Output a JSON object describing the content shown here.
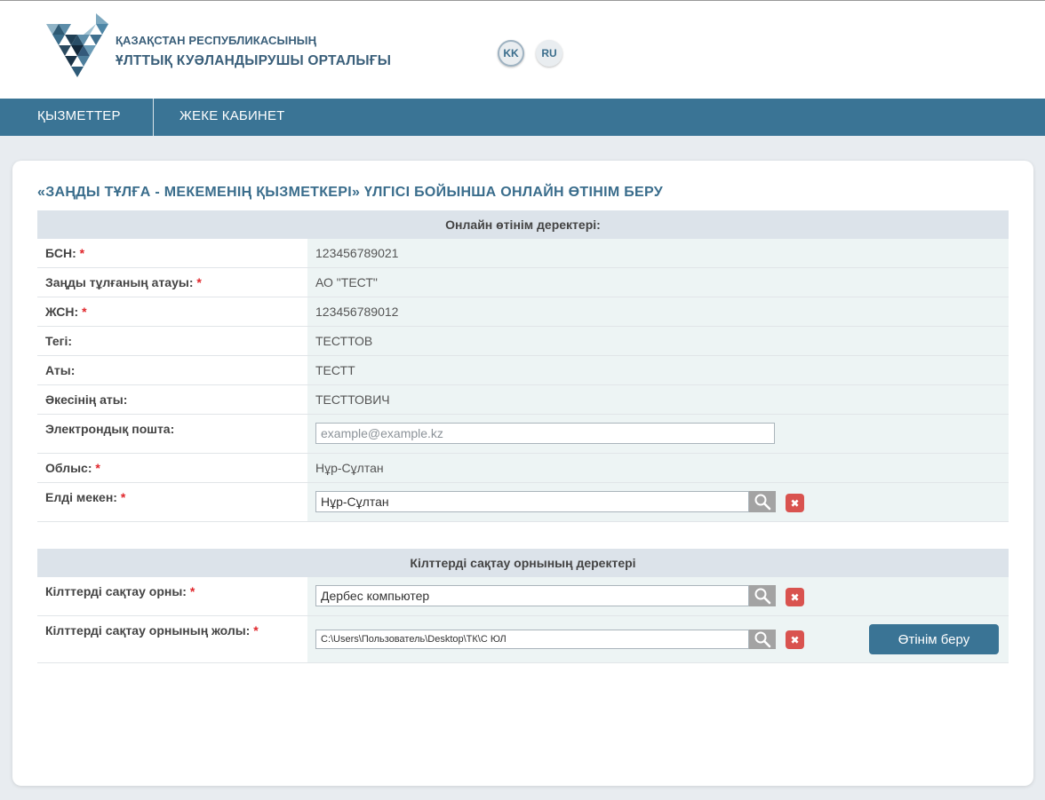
{
  "header": {
    "org_line1": "ҚАЗАҚСТАН РЕСПУБЛИКАСЫНЫҢ",
    "org_line2": "ҰЛТТЫҚ КУӘЛАНДЫРУШЫ ОРТАЛЫҒЫ",
    "languages": [
      "KK",
      "RU"
    ],
    "active_language": "KK"
  },
  "nav": {
    "items": [
      "ҚЫЗМЕТТЕР",
      "ЖЕКЕ КАБИНЕТ"
    ]
  },
  "page": {
    "title": "«ЗАҢДЫ ТҰЛҒА - МЕКЕМЕНІҢ ҚЫЗМЕТКЕРІ» ҮЛГІСІ БОЙЫНША ОНЛАЙН ӨТІНІМ БЕРУ"
  },
  "section1": {
    "title": "Онлайн өтінім деректері:",
    "bin_label": "БСН:",
    "bin_value": "123456789021",
    "org_name_label": "Заңды тұлғаның атауы:",
    "org_name_value": "АО \"ТЕСТ\"",
    "iin_label": "ЖСН:",
    "iin_value": "123456789012",
    "surname_label": "Тегі:",
    "surname_value": "ТЕСТТОВ",
    "name_label": "Аты:",
    "name_value": "ТЕСТТ",
    "patronymic_label": "Әкесінің аты:",
    "patronymic_value": "ТЕСТТОВИЧ",
    "email_label": "Электрондық пошта:",
    "email_placeholder": "example@example.kz",
    "email_value": "",
    "region_label": "Облыс:",
    "region_value": "Нұр-Сұлтан",
    "locality_label": "Елді мекен:",
    "locality_value": "Нұр-Сұлтан"
  },
  "section2": {
    "title": "Кілттерді сақтау орнының деректері",
    "storage_label": "Кілттерді сақтау орны:",
    "storage_value": "Дербес компьютер",
    "path_label": "Кілттерді сақтау орнының жолы:",
    "path_value": "C:\\Users\\Пользователь\\Desktop\\ТК\\С ЮЛ",
    "submit_label": "Өтінім беру"
  },
  "icons": {
    "search": "search-icon",
    "clear": "close-icon"
  },
  "colors": {
    "brand": "#3a7495",
    "title": "#3a6d8c",
    "required": "#e0262b",
    "danger": "#d9534f"
  }
}
